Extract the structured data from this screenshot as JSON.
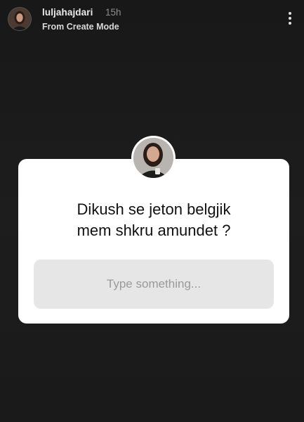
{
  "header": {
    "username": "luljahajdari",
    "time_ago": "15h",
    "subtitle": "From Create Mode"
  },
  "icons": {
    "avatar": "profile-photo",
    "more": "vertical-ellipsis-icon"
  },
  "question_sticker": {
    "question_line_1": "Dikush se jeton belgjik",
    "question_line_2": "mem shkru amundet ?",
    "answer_placeholder": "Type something..."
  },
  "colors": {
    "background": "#1b1b1b",
    "card": "#ffffff",
    "input_bg": "#e6e6e6",
    "placeholder": "#9a9a9a"
  }
}
